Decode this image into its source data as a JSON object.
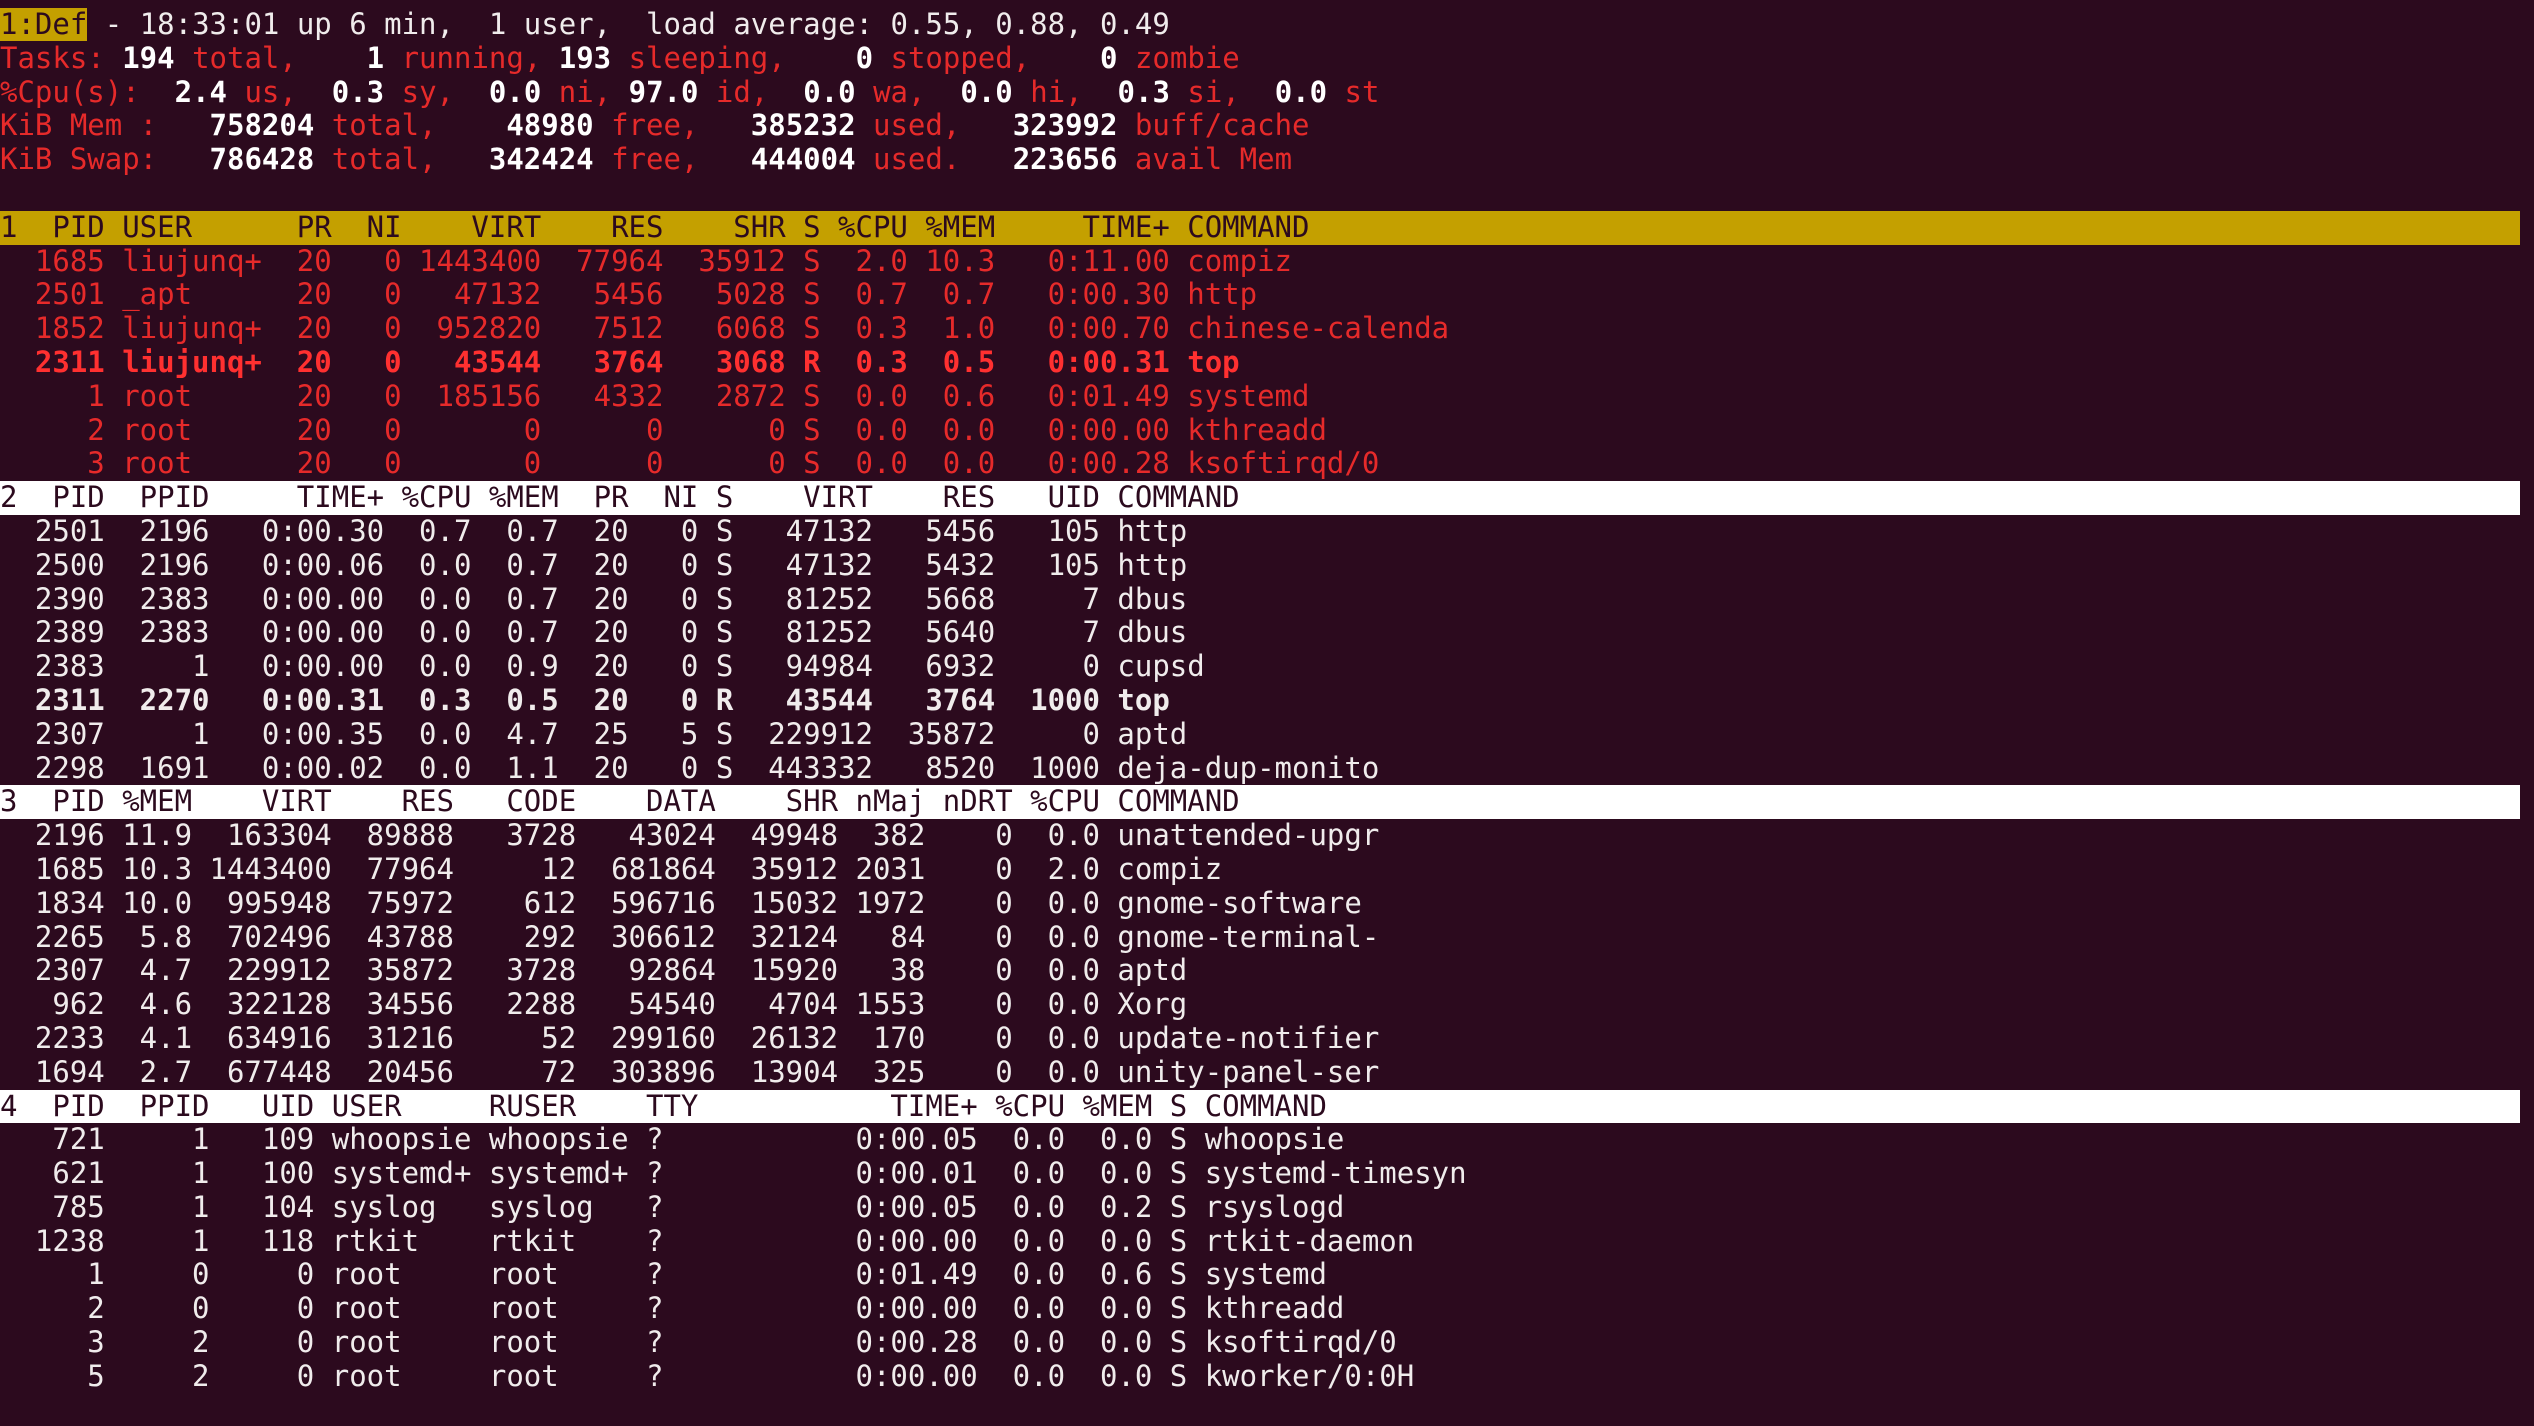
{
  "summary": {
    "win_tag": "1:Def",
    "uptime_line": " - 18:33:01 up 6 min,  1 user,  load average: 0.55, 0.88, 0.49",
    "tasks": {
      "label": "Tasks:",
      "total": " 194",
      "total_label": " total,",
      "running": "    1",
      "running_label": " running,",
      "sleeping": " 193",
      "sleeping_label": " sleeping,",
      "stopped": "    0",
      "stopped_label": " stopped,",
      "zombie": "    0",
      "zombie_label": " zombie"
    },
    "cpu": {
      "label": "%Cpu(s):",
      "us": "  2.4",
      "us_label": " us,",
      "sy": "  0.3",
      "sy_label": " sy,",
      "ni": "  0.0",
      "ni_label": " ni,",
      "id": " 97.0",
      "id_label": " id,",
      "wa": "  0.0",
      "wa_label": " wa,",
      "hi": "  0.0",
      "hi_label": " hi,",
      "si": "  0.3",
      "si_label": " si,",
      "st": "  0.0",
      "st_label": " st"
    },
    "mem": {
      "label": "KiB Mem :",
      "total": "   758204",
      "total_label": " total,",
      "free": "    48980",
      "free_label": " free,",
      "used": "   385232",
      "used_label": " used,",
      "buff": "   323992",
      "buff_label": " buff/cache"
    },
    "swap": {
      "label": "KiB Swap:",
      "total": "   786428",
      "total_label": " total,",
      "free": "   342424",
      "free_label": " free,",
      "used": "   444004",
      "used_label": " used.",
      "avail": "   223656",
      "avail_label": " avail Mem"
    }
  },
  "windows": [
    {
      "header": "1  PID USER      PR  NI    VIRT    RES    SHR S %CPU %MEM     TIME+ COMMAND",
      "style": "yellow",
      "rows": [
        {
          "text": "  1685 liujunq+  20   0 1443400  77964  35912 S  2.0 10.3   0:11.00 compiz",
          "bold": false
        },
        {
          "text": "  2501 _apt      20   0   47132   5456   5028 S  0.7  0.7   0:00.30 http",
          "bold": false
        },
        {
          "text": "  1852 liujunq+  20   0  952820   7512   6068 S  0.3  1.0   0:00.70 chinese-calenda",
          "bold": false
        },
        {
          "text": "  2311 liujunq+  20   0   43544   3764   3068 R  0.3  0.5   0:00.31 top",
          "bold": true
        },
        {
          "text": "     1 root      20   0  185156   4332   2872 S  0.0  0.6   0:01.49 systemd",
          "bold": false
        },
        {
          "text": "     2 root      20   0       0      0      0 S  0.0  0.0   0:00.00 kthreadd",
          "bold": false
        },
        {
          "text": "     3 root      20   0       0      0      0 S  0.0  0.0   0:00.28 ksoftirqd/0",
          "bold": false
        }
      ]
    },
    {
      "header": "2  PID  PPID     TIME+ %CPU %MEM  PR  NI S    VIRT    RES   UID COMMAND",
      "style": "white",
      "rows": [
        {
          "text": "  2501  2196   0:00.30  0.7  0.7  20   0 S   47132   5456   105 http",
          "bold": false
        },
        {
          "text": "  2500  2196   0:00.06  0.0  0.7  20   0 S   47132   5432   105 http",
          "bold": false
        },
        {
          "text": "  2390  2383   0:00.00  0.0  0.7  20   0 S   81252   5668     7 dbus",
          "bold": false
        },
        {
          "text": "  2389  2383   0:00.00  0.0  0.7  20   0 S   81252   5640     7 dbus",
          "bold": false
        },
        {
          "text": "  2383     1   0:00.00  0.0  0.9  20   0 S   94984   6932     0 cupsd",
          "bold": false
        },
        {
          "text": "  2311  2270   0:00.31  0.3  0.5  20   0 R   43544   3764  1000 top",
          "bold": true
        },
        {
          "text": "  2307     1   0:00.35  0.0  4.7  25   5 S  229912  35872     0 aptd",
          "bold": false
        },
        {
          "text": "  2298  1691   0:00.02  0.0  1.1  20   0 S  443332   8520  1000 deja-dup-monito",
          "bold": false
        }
      ]
    },
    {
      "header": "3  PID %MEM    VIRT    RES   CODE    DATA    SHR nMaj nDRT %CPU COMMAND",
      "style": "white",
      "rows": [
        {
          "text": "  2196 11.9  163304  89888   3728   43024  49948  382    0  0.0 unattended-upgr",
          "bold": false
        },
        {
          "text": "  1685 10.3 1443400  77964     12  681864  35912 2031    0  2.0 compiz",
          "bold": false
        },
        {
          "text": "  1834 10.0  995948  75972    612  596716  15032 1972    0  0.0 gnome-software",
          "bold": false
        },
        {
          "text": "  2265  5.8  702496  43788    292  306612  32124   84    0  0.0 gnome-terminal-",
          "bold": false
        },
        {
          "text": "  2307  4.7  229912  35872   3728   92864  15920   38    0  0.0 aptd",
          "bold": false
        },
        {
          "text": "   962  4.6  322128  34556   2288   54540   4704 1553    0  0.0 Xorg",
          "bold": false
        },
        {
          "text": "  2233  4.1  634916  31216     52  299160  26132  170    0  0.0 update-notifier",
          "bold": false
        },
        {
          "text": "  1694  2.7  677448  20456     72  303896  13904  325    0  0.0 unity-panel-ser",
          "bold": false
        }
      ]
    },
    {
      "header": "4  PID  PPID   UID USER     RUSER    TTY           TIME+ %CPU %MEM S COMMAND",
      "style": "white",
      "rows": [
        {
          "text": "   721     1   109 whoopsie whoopsie ?           0:00.05  0.0  0.0 S whoopsie",
          "bold": false
        },
        {
          "text": "   621     1   100 systemd+ systemd+ ?           0:00.01  0.0  0.0 S systemd-timesyn",
          "bold": false
        },
        {
          "text": "   785     1   104 syslog   syslog   ?           0:00.05  0.0  0.2 S rsyslogd",
          "bold": false
        },
        {
          "text": "  1238     1   118 rtkit    rtkit    ?           0:00.00  0.0  0.0 S rtkit-daemon",
          "bold": false
        },
        {
          "text": "     1     0     0 root     root     ?           0:01.49  0.0  0.6 S systemd",
          "bold": false
        },
        {
          "text": "     2     0     0 root     root     ?           0:00.00  0.0  0.0 S kthreadd",
          "bold": false
        },
        {
          "text": "     3     2     0 root     root     ?           0:00.28  0.0  0.0 S ksoftirqd/0",
          "bold": false
        },
        {
          "text": "     5     2     0 root     root     ?           0:00.00  0.0  0.0 S kworker/0:0H",
          "bold": false
        }
      ]
    }
  ],
  "colors": {
    "background": "#2c0a1e",
    "label_red": "#e62a2a",
    "text": "#f0ecec",
    "current_window_header": "#c4a000",
    "other_window_header": "#ffffff"
  }
}
